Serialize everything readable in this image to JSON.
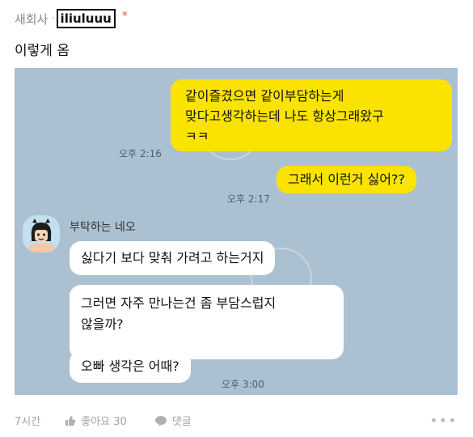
{
  "header": {
    "author": "새회사",
    "separator": "·",
    "user_id": "iliuluuu",
    "star": "*"
  },
  "post": {
    "title": "이렇게 옴"
  },
  "chat": {
    "messages": [
      {
        "lines": [
          "같이즐겼으면 같이부담하는게",
          "맞다고생각하는데 나도 항상그래왔구",
          "ㅋㅋ"
        ],
        "time": "오후 2:16"
      },
      {
        "text": "그래서 이런거 싫어??",
        "time": "오후 2:17"
      }
    ],
    "sender": "부탁하는 네오",
    "replies": [
      {
        "text": "싫다기 보다 맞춰 가려고 하는거지"
      },
      {
        "lines": [
          "그러면 자주 만나는건 좀 부담스럽지",
          "않을까?"
        ]
      },
      {
        "text": "오빠 생각은 어때?",
        "time": "오후 3:00"
      }
    ],
    "colors": {
      "background": "#abc1d1",
      "mine": "#fae300",
      "theirs": "#ffffff"
    }
  },
  "footer": {
    "time": "7시간",
    "like": "좋아요 30",
    "comment": "댓글",
    "more": "•••"
  }
}
